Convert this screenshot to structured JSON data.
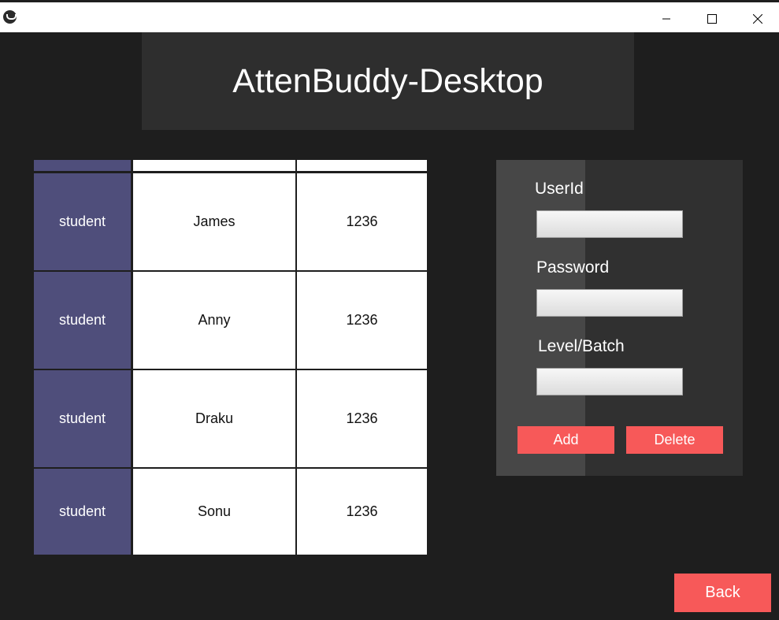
{
  "window": {
    "app_icon": "kivy-logo-icon",
    "controls": {
      "minimize_icon": "minimize-icon",
      "maximize_icon": "maximize-icon",
      "close_icon": "close-icon"
    }
  },
  "header": {
    "title": "AttenBuddy-Desktop"
  },
  "table": {
    "columns": [
      "role",
      "name",
      "id"
    ],
    "partial_top_row": {
      "role": "",
      "name": "",
      "id": ""
    },
    "rows": [
      {
        "role": "student",
        "name": "James",
        "id": "1236"
      },
      {
        "role": "student",
        "name": "Anny",
        "id": "1236"
      },
      {
        "role": "student",
        "name": "Draku",
        "id": "1236"
      },
      {
        "role": "student",
        "name": "Sonu",
        "id": "1236"
      }
    ]
  },
  "form": {
    "userid_label": "UserId",
    "userid_value": "",
    "password_label": "Password",
    "password_value": "",
    "level_label": "Level/Batch",
    "level_value": "",
    "add_label": "Add",
    "delete_label": "Delete"
  },
  "back_label": "Back",
  "colors": {
    "background": "#1e1e1e",
    "header_bg": "#2e2e2e",
    "role_cell": "#4f4e7b",
    "accent_button": "#f75959",
    "panel_dark": "#303030",
    "panel_light": "#474747"
  }
}
